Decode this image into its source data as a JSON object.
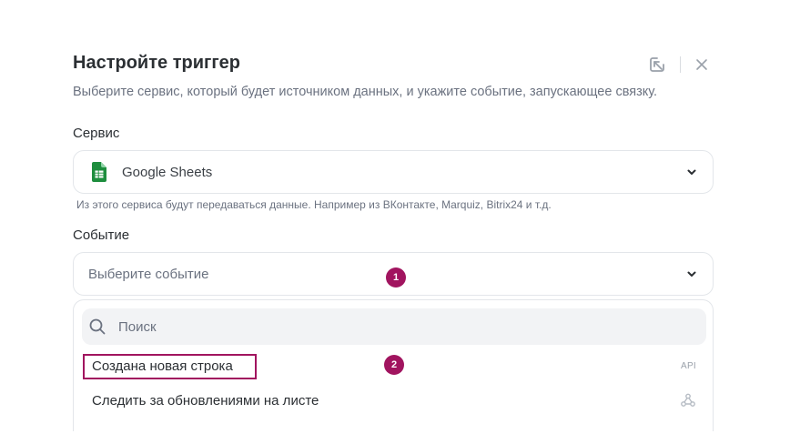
{
  "modal": {
    "title": "Настройте триггер",
    "subtitle": "Выберите сервис, который будет источником данных, и укажите событие, запускающее связку."
  },
  "service": {
    "label": "Сервис",
    "selected": "Google Sheets",
    "icon": "google-sheets-icon",
    "hint": "Из этого сервиса будут передаваться данные. Например из ВКонтакте, Marquiz, Bitrix24 и т.д."
  },
  "event": {
    "label": "Событие",
    "placeholder": "Выберите событие"
  },
  "dropdown": {
    "search_placeholder": "Поиск",
    "options": [
      {
        "label": "Создана новая строка",
        "tag": "API"
      },
      {
        "label": "Следить за обновлениями на листе",
        "tag_icon": "webhook-icon"
      }
    ]
  },
  "badges": {
    "first": "1",
    "second": "2"
  },
  "colors": {
    "accent": "#a1145f",
    "sheets_green": "#1e8e3e"
  }
}
